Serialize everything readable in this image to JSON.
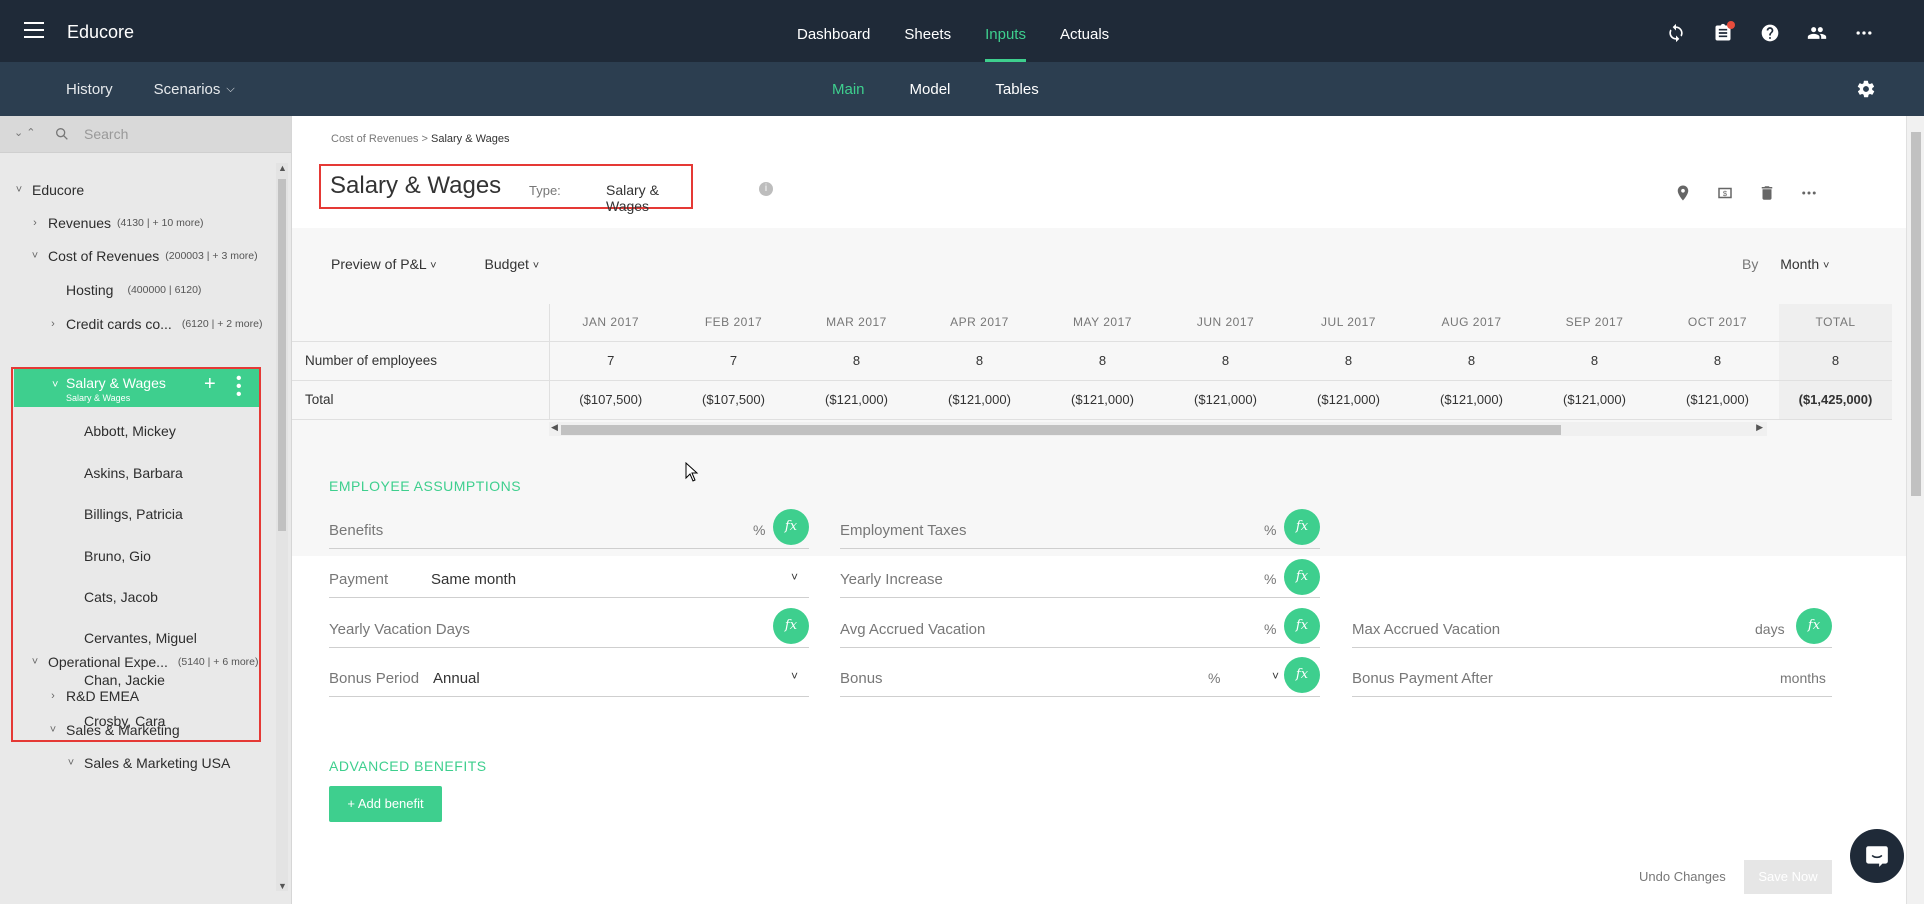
{
  "app": {
    "title": "Educore"
  },
  "topnav": [
    "Dashboard",
    "Sheets",
    "Inputs",
    "Actuals"
  ],
  "topnav_active": "Inputs",
  "subbar": {
    "history": "History",
    "scenarios": "Scenarios",
    "tabs": [
      "Main",
      "Model",
      "Tables"
    ]
  },
  "search": {
    "placeholder": "Search"
  },
  "tree": [
    {
      "label": "Educore",
      "count": "",
      "chev": "˅"
    },
    {
      "label": "Revenues",
      "count": "(4130 | + 10 more)",
      "chev": "›"
    },
    {
      "label": "Cost of Revenues",
      "count": "(200003 | + 3 more)",
      "chev": "˅"
    },
    {
      "label": "Hosting",
      "count": "(400000 | 6120)",
      "chev": ""
    },
    {
      "label": "Credit cards co...",
      "count": "(6120 | + 2 more)",
      "chev": "›"
    },
    {
      "label": "Operational Expe...",
      "count": "(5140 | + 6 more)",
      "chev": "˅"
    },
    {
      "label": "R&D EMEA",
      "count": "",
      "chev": "›"
    },
    {
      "label": "Sales & Marketing",
      "count": "",
      "chev": "˅"
    },
    {
      "label": "Sales & Marketing USA",
      "count": "",
      "chev": "˅"
    }
  ],
  "selected": {
    "name": "Salary & Wages",
    "sub": "Salary & Wages"
  },
  "employees": [
    "Abbott, Mickey",
    "Askins, Barbara",
    "Billings, Patricia",
    "Bruno, Gio",
    "Cats, Jacob",
    "Cervantes, Miguel",
    "Chan, Jackie",
    "Crosby, Cara"
  ],
  "breadcrumb": {
    "parent": "Cost of Revenues",
    "sep": " > ",
    "current": "Salary & Wages"
  },
  "page": {
    "title": "Salary & Wages",
    "type_label": "Type:",
    "type_value": "Salary & Wages"
  },
  "filters": {
    "view": "Preview of P&L",
    "scenario": "Budget",
    "by_label": "By",
    "by_value": "Month"
  },
  "grid": {
    "months": [
      "JAN 2017",
      "FEB 2017",
      "MAR 2017",
      "APR 2017",
      "MAY 2017",
      "JUN 2017",
      "JUL 2017",
      "AUG 2017",
      "SEP 2017",
      "OCT 2017"
    ],
    "total_header": "TOTAL",
    "rows": [
      {
        "label": "Number of employees",
        "values": [
          "7",
          "7",
          "8",
          "8",
          "8",
          "8",
          "8",
          "8",
          "8",
          "8"
        ],
        "total": "8"
      },
      {
        "label": "Total",
        "values": [
          "($107,500)",
          "($107,500)",
          "($121,000)",
          "($121,000)",
          "($121,000)",
          "($121,000)",
          "($121,000)",
          "($121,000)",
          "($121,000)",
          "($121,000)"
        ],
        "total": "($1,425,000)"
      }
    ]
  },
  "assumptions": {
    "title": "EMPLOYEE ASSUMPTIONS",
    "benefits": "Benefits",
    "employment_taxes": "Employment Taxes",
    "payment": "Payment",
    "payment_value": "Same month",
    "yearly_increase": "Yearly Increase",
    "vacation_days": "Yearly Vacation Days",
    "avg_accrued": "Avg Accrued Vacation",
    "max_accrued": "Max Accrued Vacation",
    "bonus_period": "Bonus Period",
    "bonus_period_value": "Annual",
    "bonus": "Bonus",
    "bonus_payment_after": "Bonus Payment After",
    "pct": "%",
    "days": "days",
    "months": "months",
    "fx": "fx"
  },
  "advanced": {
    "title": "ADVANCED BENEFITS",
    "add": "+ Add benefit"
  },
  "footer": {
    "undo": "Undo Changes",
    "save": "Save Now"
  }
}
